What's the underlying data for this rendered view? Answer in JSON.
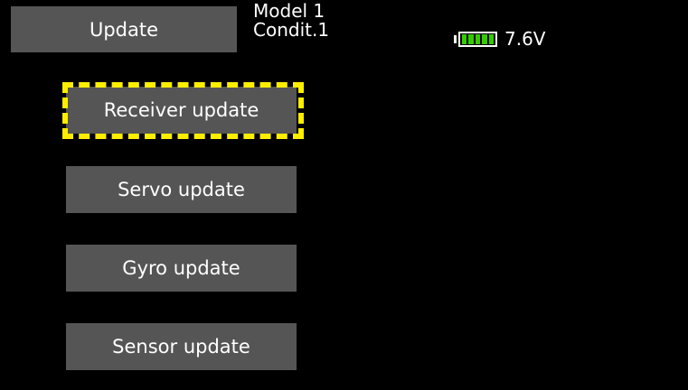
{
  "screen": {
    "background": "#000000"
  },
  "header": {
    "title": "Update",
    "model_line1": "Model 1",
    "model_line2": "Condit.1"
  },
  "battery": {
    "voltage": "7.6V",
    "level_fraction": 1.0,
    "segment_color": "#33cc00",
    "icon": "battery-icon"
  },
  "menu": {
    "items": [
      {
        "label": "Receiver update",
        "selected": true
      },
      {
        "label": "Servo update",
        "selected": false
      },
      {
        "label": "Gyro update",
        "selected": false
      },
      {
        "label": "Sensor update",
        "selected": false
      }
    ],
    "highlight_color": "#ffee00",
    "button_color": "#555555"
  }
}
